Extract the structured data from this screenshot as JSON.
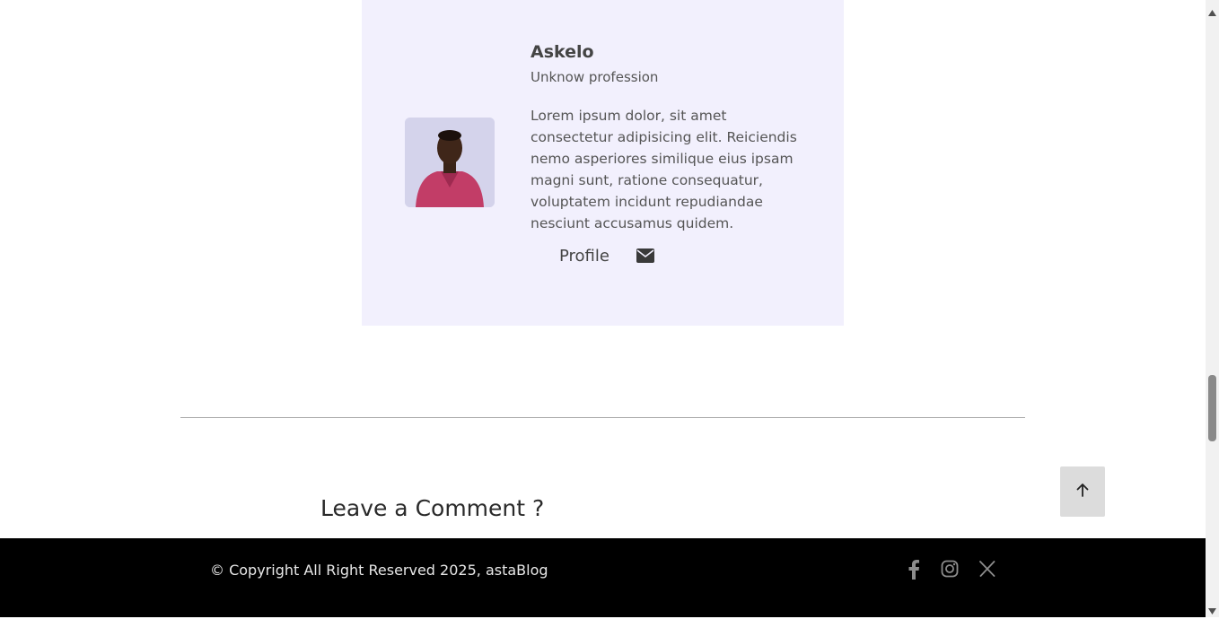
{
  "author": {
    "name": "Askelo",
    "profession": "Unknow profession",
    "bio": "Lorem ipsum dolor, sit amet consectetur adipisicing elit. Reiciendis nemo asperiores similique eius ipsam magni sunt, ratione consequatur, voluptatem incidunt repudiandae nesciunt accusamus quidem.",
    "profile_label": "Profile",
    "mail_icon": "envelope-icon"
  },
  "comments": {
    "heading": "Leave a Comment ?"
  },
  "back_to_top_icon": "arrow-up-icon",
  "footer": {
    "copyright": "© Copyright All Right Reserved 2025, astaBlog",
    "social": [
      "facebook-icon",
      "instagram-icon",
      "x-icon"
    ]
  },
  "colors": {
    "card_background": "#f2f0fd",
    "footer_background": "#000000",
    "back_to_top_background": "#dcdcdc"
  }
}
